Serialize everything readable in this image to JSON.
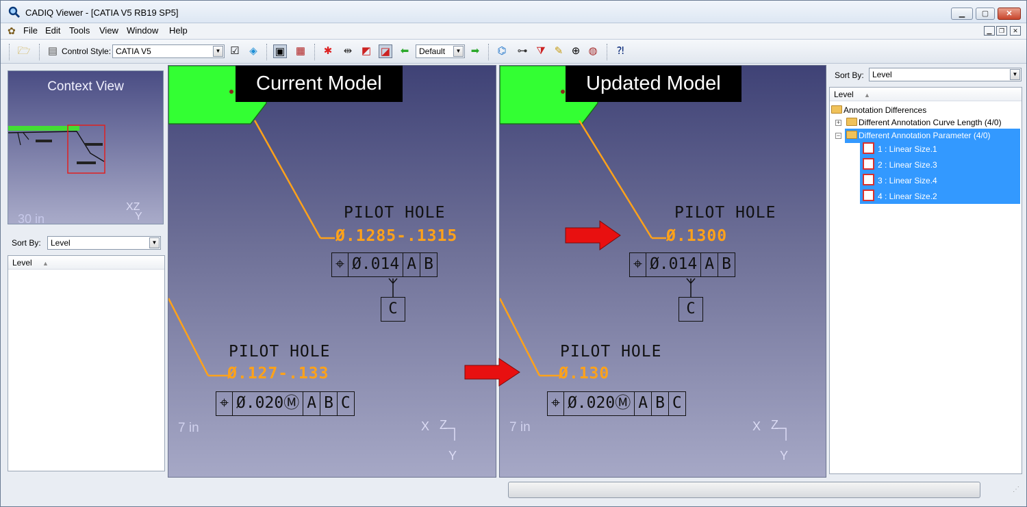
{
  "window": {
    "title": "CADIQ Viewer - [CATIA V5 RB19 SP5]",
    "buttons": [
      "▁",
      "▢",
      "✕"
    ],
    "mdi_buttons": [
      "▁",
      "❐",
      "✕"
    ]
  },
  "menu": {
    "items": [
      "File",
      "Edit",
      "Tools",
      "View",
      "Window",
      "Help"
    ]
  },
  "toolbar": {
    "control_style_label": "Control Style:",
    "control_style_value": "CATIA V5",
    "view_value": "Default"
  },
  "context_view": {
    "title": "Context View",
    "scale": "30 in",
    "axis": "XZ\n   Y"
  },
  "left_sort": {
    "label": "Sort By:",
    "value": "Level",
    "column": "Level"
  },
  "current_model": {
    "label": "Current Model",
    "upper": {
      "title": "PILOT HOLE",
      "dim": "Ø.1285-.1315",
      "fcf": [
        "⌖",
        "Ø.014",
        "A",
        "B"
      ],
      "datum": "C"
    },
    "lower": {
      "title": "PILOT HOLE",
      "dim": "Ø.127-.133",
      "fcf": [
        "⌖",
        "Ø.020Ⓜ",
        "A",
        "B",
        "C"
      ]
    },
    "scale": "7 in",
    "axis_x": "X",
    "axis_z": "Z",
    "axis_y": "Y"
  },
  "updated_model": {
    "label": "Updated Model",
    "upper": {
      "title": "PILOT HOLE",
      "dim": "Ø.1300",
      "fcf": [
        "⌖",
        "Ø.014",
        "A",
        "B"
      ],
      "datum": "C"
    },
    "lower": {
      "title": "PILOT HOLE",
      "dim": "Ø.130",
      "fcf": [
        "⌖",
        "Ø.020Ⓜ",
        "A",
        "B",
        "C"
      ]
    },
    "scale": "7 in",
    "axis_x": "X",
    "axis_z": "Z",
    "axis_y": "Y"
  },
  "right_panel": {
    "sort_label": "Sort By:",
    "sort_value": "Level",
    "column": "Level",
    "root": "Annotation Differences",
    "groups": [
      {
        "label": "Different Annotation Curve Length (4/0)",
        "expanded": false
      },
      {
        "label": "Different Annotation Parameter (4/0)",
        "expanded": true
      }
    ],
    "items": [
      "1 : Linear Size.1",
      "2 : Linear Size.3",
      "3 : Linear Size.4",
      "4 : Linear Size.2"
    ]
  },
  "colors": {
    "annotation": "#ffa21a",
    "model_green": "#33ff33",
    "arrow_red": "#e81010",
    "selection": "#3399ff"
  }
}
